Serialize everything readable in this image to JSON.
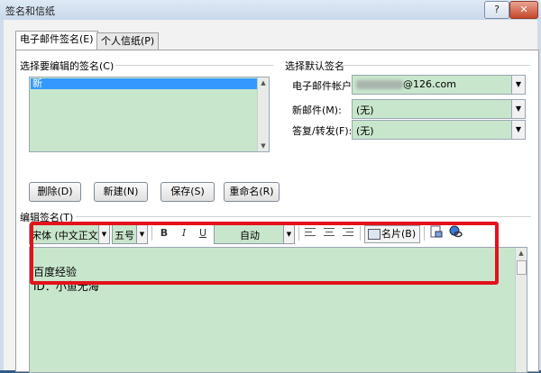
{
  "window": {
    "title": "签名和信纸",
    "help_label": "?",
    "close_label": "✕"
  },
  "tabs": [
    {
      "label": "电子邮件签名(E)",
      "active": true
    },
    {
      "label": "个人信纸(P)",
      "active": false
    }
  ],
  "signature_list": {
    "heading": "选择要编辑的签名(C)",
    "items": [
      "新"
    ],
    "selected_index": 0
  },
  "buttons": {
    "delete": "删除(D)",
    "new": "新建(N)",
    "save": "保存(S)",
    "rename": "重命名(R)"
  },
  "default_signature": {
    "heading": "选择默认签名",
    "account_label": "电子邮件帐户(A):",
    "account_value_suffix": "@126.com",
    "new_messages_label": "新邮件(M):",
    "new_messages_value": "(无)",
    "replies_label": "答复/转发(F):",
    "replies_value": "(无)"
  },
  "editor": {
    "heading": "编辑签名(T)",
    "font": "宋体 (中文正文)",
    "size": "五号",
    "bold": "B",
    "italic": "I",
    "underline": "U",
    "color": "自动",
    "business_card": "名片(B)",
    "lines": [
      "百度经验",
      "ID：小鱼无海"
    ]
  },
  "colors": {
    "field_bg": "#c8e6cc",
    "highlight": "#e3121b",
    "selection": "#3399ff"
  },
  "icons": {
    "help": "help-icon",
    "close": "close-icon",
    "insert_picture": "insert-picture-icon",
    "insert_hyperlink": "insert-hyperlink-icon"
  }
}
